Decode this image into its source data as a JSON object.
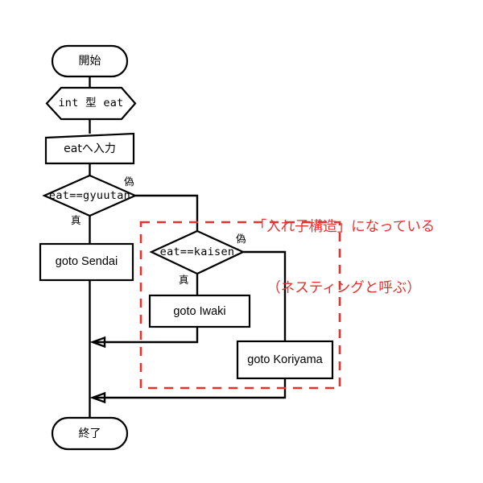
{
  "diagram": {
    "title_text": "",
    "colors": {
      "stroke": "#000000",
      "background": "#ffffff",
      "annotation": "#e8312f"
    },
    "nodes": {
      "start": {
        "label": "開始",
        "shape": "terminator"
      },
      "declare": {
        "label": "int 型 eat",
        "shape": "hexagon"
      },
      "input": {
        "label": "eatへ入力",
        "shape": "parallelogram"
      },
      "decision_gyuutan": {
        "label": "eat==gyuutan",
        "shape": "diamond"
      },
      "goto_sendai": {
        "label": "goto Sendai",
        "shape": "process"
      },
      "decision_kaisen": {
        "label": "eat==kaisen",
        "shape": "diamond"
      },
      "goto_iwaki": {
        "label": "goto Iwaki",
        "shape": "process"
      },
      "goto_koriyama": {
        "label": "goto Koriyama",
        "shape": "process"
      },
      "end": {
        "label": "終了",
        "shape": "terminator"
      }
    },
    "branch_labels": {
      "gyuutan_false": "偽",
      "gyuutan_true": "真",
      "kaisen_false": "偽",
      "kaisen_true": "真"
    },
    "annotation": {
      "line1": "「入れ子構造」になっている",
      "line2": "（ネスティングと呼ぶ）"
    }
  }
}
